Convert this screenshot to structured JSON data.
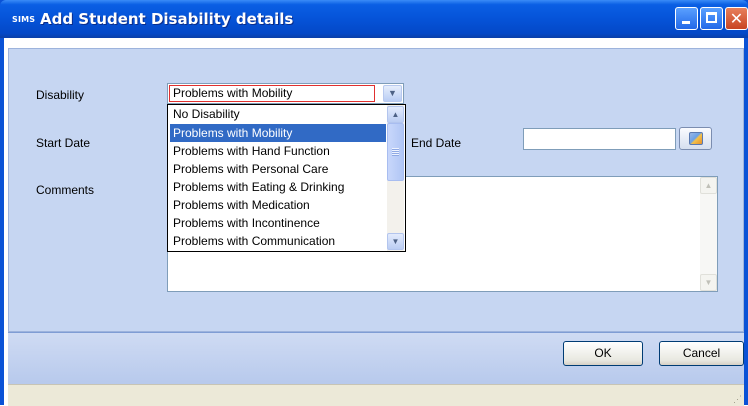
{
  "window": {
    "app_logo": "SIMS",
    "title": "Add Student Disability details"
  },
  "form": {
    "disability_label": "Disability",
    "disability_value": "Problems with Mobility",
    "start_date_label": "Start Date",
    "end_date_label": "End Date",
    "end_date_value": "",
    "comments_label": "Comments",
    "comments_value": ""
  },
  "dropdown": {
    "options": [
      "No Disability",
      "Problems with Mobility",
      "Problems with Hand Function",
      "Problems with Personal Care",
      "Problems with Eating & Drinking",
      "Problems with Medication",
      "Problems with Incontinence",
      "Problems with Communication"
    ],
    "selected_index": 1
  },
  "buttons": {
    "ok": "OK",
    "cancel": "Cancel"
  },
  "icons": {
    "minimize": "minimize-icon",
    "maximize": "maximize-icon",
    "close": "close-icon",
    "calendar": "calendar-icon",
    "dropdown_arrow": "chevron-down-icon"
  },
  "colors": {
    "titlebar": "#0553d8",
    "panel": "#c6d6f2",
    "selection": "#316ac5",
    "focus_border": "#e03030"
  }
}
